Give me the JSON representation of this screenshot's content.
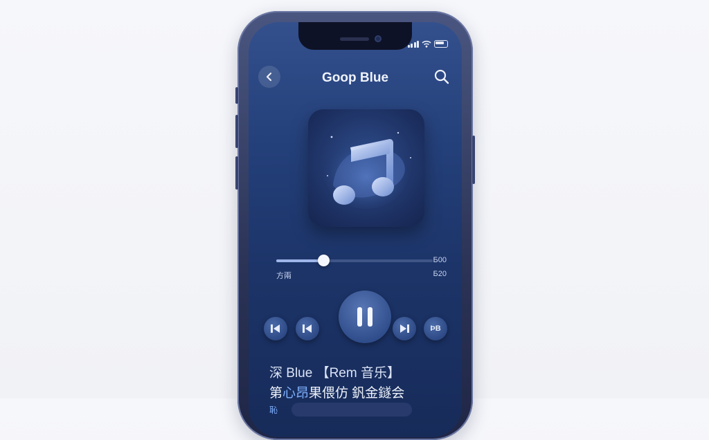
{
  "header": {
    "title": "Goop Blue"
  },
  "player": {
    "progress_fraction": 0.3,
    "time_right_top": "Б00",
    "time_left": "方兩",
    "time_right_bottom": "Б20",
    "side_right_label": "ÞB"
  },
  "song": {
    "title_line": "深 Blue 【Rem 音乐】",
    "artist_pre": "第",
    "artist_highlight": "心昂",
    "artist_post": "果偎仿  釩金鐩会",
    "cut_text": "恥"
  },
  "icons": {
    "back": "chevron-left-icon",
    "search": "search-icon",
    "album_art": "music-note-icon",
    "prev_outer": "skip-previous-icon",
    "prev_inner": "previous-icon",
    "play_pause": "pause-icon",
    "next": "next-icon"
  },
  "colors": {
    "screen_top": "#33508d",
    "screen_bottom": "#172b59",
    "accent": "#9fb6ea",
    "highlight": "#7fb0ff"
  }
}
